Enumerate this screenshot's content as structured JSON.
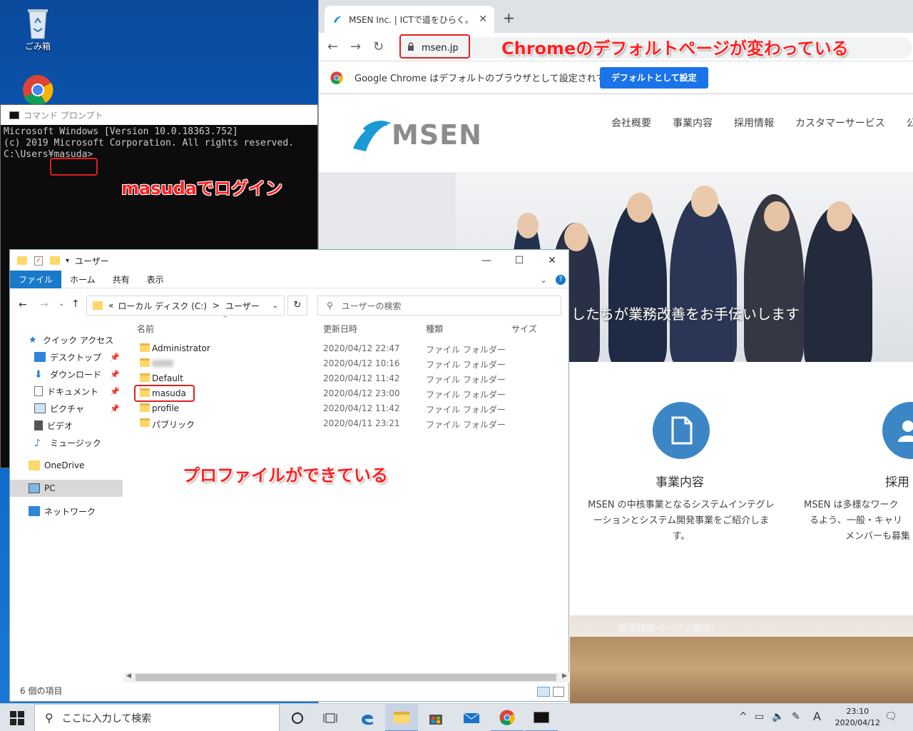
{
  "desktop": {
    "recycle_bin_label": "ごみ箱"
  },
  "chrome": {
    "tab_title": "MSEN Inc. | ICTで道をひらく。",
    "url": "msen.jp",
    "default_notice": "Google Chrome はデフォルトのブラウザとして設定されていません",
    "set_default_button": "デフォルトとして設定",
    "site": {
      "logo_text": "MSEN",
      "nav": [
        "会社概要",
        "事業内容",
        "採用情報",
        "カスタマーサービス",
        "公"
      ],
      "hero_caption": "したちが業務改善をお手伝いします",
      "services": [
        {
          "title": "事業内容",
          "lines": [
            "MSEN の中核事業となるシステムインテグレ",
            "ーションとシステム開発事業をご紹介しま",
            "す。"
          ]
        },
        {
          "title": "採用",
          "lines": [
            "MSEN は多様なワーク",
            "るよう、一般・キャリ",
            "メンバーも募集"
          ]
        }
      ],
      "banner_text": "採用特設ページ公開中！"
    }
  },
  "cmd": {
    "title": "コマンド プロンプト",
    "lines": [
      "Microsoft Windows [Version 10.0.18363.752]",
      "(c) 2019 Microsoft Corporation. All rights reserved.",
      "",
      "C:\\Users¥masuda>"
    ]
  },
  "explorer": {
    "title": "ユーザー",
    "ribbon": [
      "ファイル",
      "ホーム",
      "共有",
      "表示"
    ],
    "address": {
      "prefix": "«",
      "crumb1": "ローカル ディスク (C:)",
      "sep": ">",
      "crumb2": "ユーザー"
    },
    "search_placeholder": "ユーザーの検索",
    "nav": {
      "quick_access": "クイック アクセス",
      "desktop": "デスクトップ",
      "downloads": "ダウンロード",
      "documents": "ドキュメント",
      "pictures": "ピクチャ",
      "videos": "ビデオ",
      "music": "ミュージック",
      "onedrive": "OneDrive",
      "pc": "PC",
      "network": "ネットワーク"
    },
    "columns": {
      "name": "名前",
      "modified": "更新日時",
      "type": "種類",
      "size": "サイズ"
    },
    "rows": [
      {
        "name": "Administrator",
        "modified": "2020/04/12 22:47",
        "type": "ファイル フォルダー"
      },
      {
        "name": "",
        "modified": "2020/04/12 10:16",
        "type": "ファイル フォルダー"
      },
      {
        "name": "Default",
        "modified": "2020/04/12 11:42",
        "type": "ファイル フォルダー"
      },
      {
        "name": "masuda",
        "modified": "2020/04/12 23:00",
        "type": "ファイル フォルダー"
      },
      {
        "name": "profile",
        "modified": "2020/04/12 11:42",
        "type": "ファイル フォルダー"
      },
      {
        "name": "パブリック",
        "modified": "2020/04/11 23:21",
        "type": "ファイル フォルダー"
      }
    ],
    "status": "6 個の項目"
  },
  "annotations": {
    "chrome_default": "Chromeのデフォルトページが変わっている",
    "login": "masudaでログイン",
    "profile": "プロファイルができている"
  },
  "taskbar": {
    "search_placeholder": "ここに入力して検索",
    "ime": "A",
    "time": "23:10",
    "date": "2020/04/12"
  },
  "colors": {
    "annotation_red": "#e02020",
    "chrome_blue": "#1a73e8",
    "msen_blue": "#3d86c6"
  }
}
